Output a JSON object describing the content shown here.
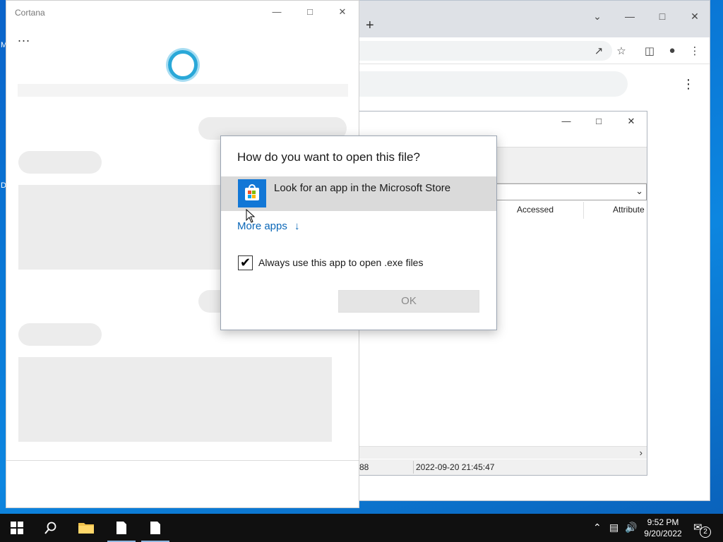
{
  "desktop": {
    "glyph_1": "M",
    "glyph_2": "D"
  },
  "browser": {
    "new_tab_icon": "plus-icon",
    "toolbar_icons": [
      "share-icon",
      "star-icon",
      "side-panel-icon",
      "profile-icon",
      "menu-kebab-icon"
    ]
  },
  "explorer": {
    "columns": {
      "accessed": "Accessed",
      "attributes": "Attribute"
    },
    "status": {
      "left_value": "88",
      "timestamp": "2022-09-20 21:45:47"
    }
  },
  "cortana": {
    "title": "Cortana",
    "more_label": "..."
  },
  "dialog": {
    "question": "How do you want to open this file?",
    "store_option_label": "Look for an app in the Microsoft Store",
    "more_apps_label": "More apps",
    "more_apps_arrow": "↓",
    "always_use_label": "Always use this app to open .exe files",
    "always_use_checked": true,
    "ok_label": "OK",
    "accent_color": "#1277d6",
    "link_color": "#0a67b8"
  },
  "taskbar": {
    "clock_time": "9:52 PM",
    "clock_date": "9/20/2022",
    "notification_count": "2",
    "pinned": [
      "start-icon",
      "search-icon",
      "file-explorer-icon",
      "document-icon",
      "document-icon"
    ]
  }
}
